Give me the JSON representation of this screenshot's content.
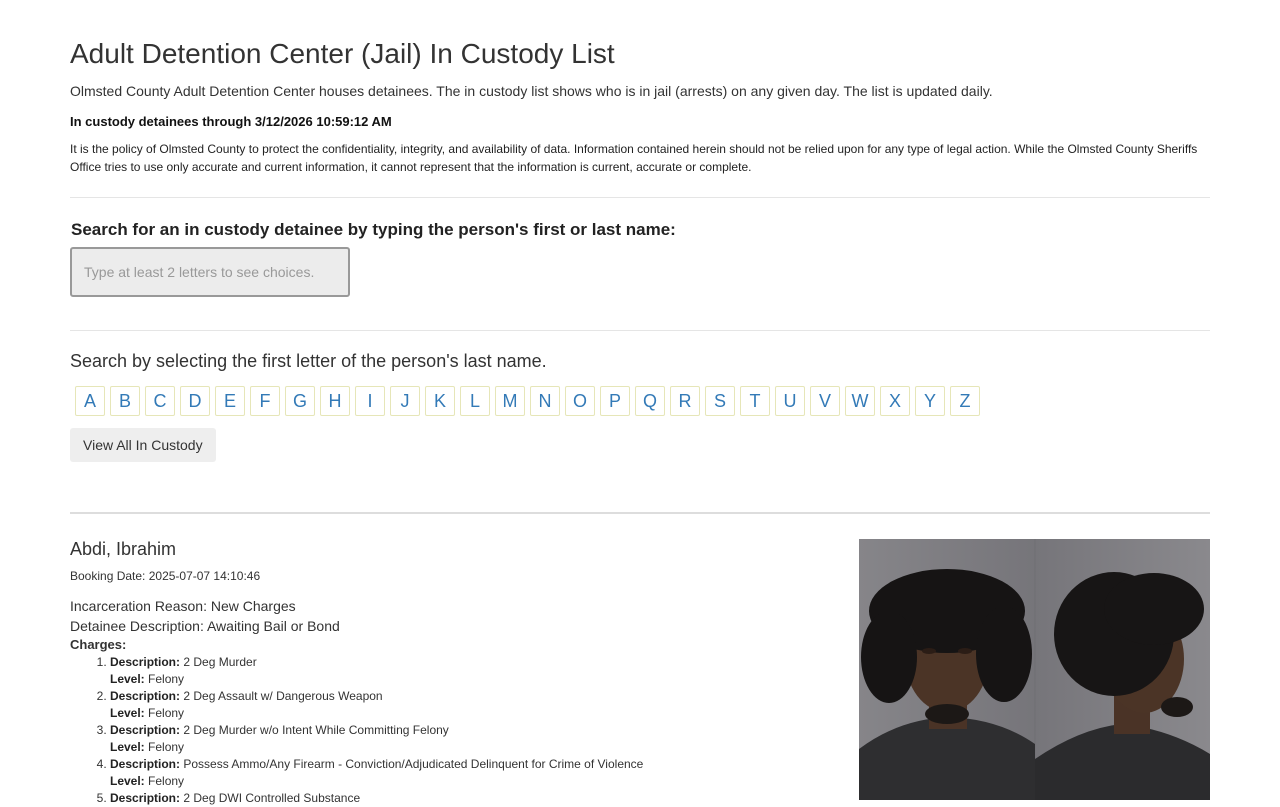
{
  "page": {
    "title": "Adult Detention Center (Jail) In Custody List",
    "intro": "Olmsted County Adult Detention Center houses detainees. The in custody list shows who is in jail (arrests) on any given day.  The list is updated daily.",
    "through": "In custody detainees through 3/12/2026 10:59:12 AM",
    "disclaimer": "It is the policy of Olmsted County to protect the confidentiality, integrity, and availability of data. Information contained herein should not be relied upon for any type of legal action. While the Olmsted County Sheriffs Office tries to use only accurate and current information, it cannot represent that the information is current, accurate or complete."
  },
  "search": {
    "label": "Search for an in custody detainee by typing the person's first or last name:",
    "placeholder": "Type at least 2 letters to see choices.",
    "value": ""
  },
  "letters": {
    "label": "Search by selecting the first letter of the person's last name.",
    "items": [
      "A",
      "B",
      "C",
      "D",
      "E",
      "F",
      "G",
      "H",
      "I",
      "J",
      "K",
      "L",
      "M",
      "N",
      "O",
      "P",
      "Q",
      "R",
      "S",
      "T",
      "U",
      "V",
      "W",
      "X",
      "Y",
      "Z"
    ],
    "view_all": "View All In Custody"
  },
  "detainee": {
    "name": "Abdi, Ibrahim",
    "booking": "Booking Date: 2025-07-07 14:10:46",
    "reason": "Incarceration Reason: New Charges",
    "description": "Detainee Description: Awaiting Bail or Bond",
    "charges_label": "Charges:",
    "desc_key": "Description:",
    "level_key": "Level:",
    "charges": [
      {
        "description": "2 Deg Murder",
        "level": "Felony"
      },
      {
        "description": "2 Deg Assault w/ Dangerous Weapon",
        "level": "Felony"
      },
      {
        "description": "2 Deg Murder w/o Intent While Committing Felony",
        "level": "Felony"
      },
      {
        "description": "Possess Ammo/Any Firearm - Conviction/Adjudicated Delinquent for Crime of Violence",
        "level": "Felony"
      },
      {
        "description": "2 Deg DWI Controlled Substance",
        "level": ""
      }
    ]
  }
}
